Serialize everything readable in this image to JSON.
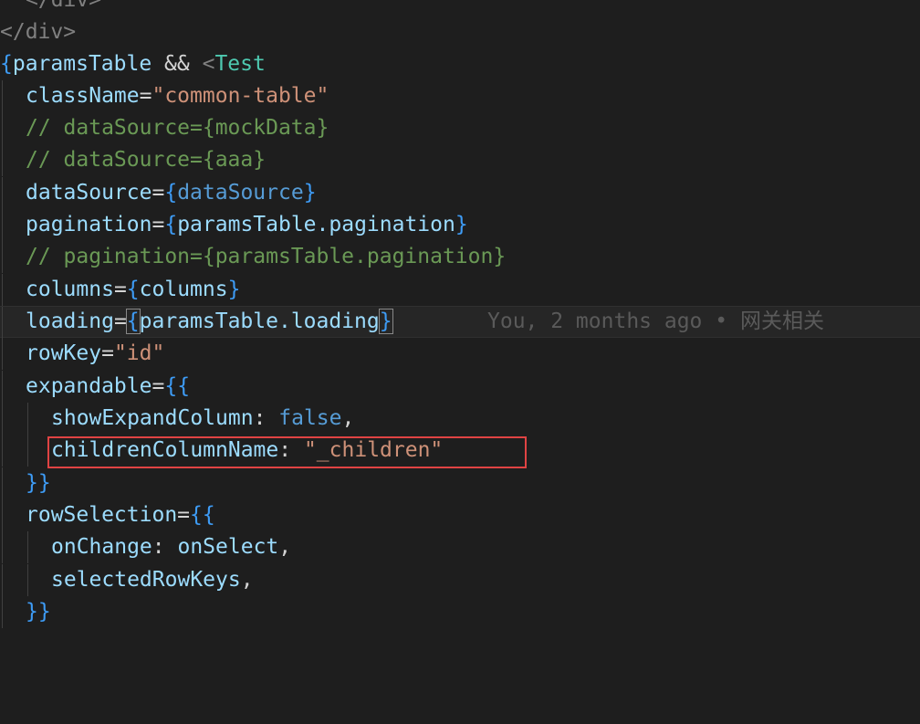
{
  "code": {
    "l0_close": "</div>",
    "l1_close": "</div>",
    "l2": {
      "open": "{",
      "ident": "paramsTable",
      "op": " && ",
      "lt": "<",
      "comp": "Test"
    },
    "l3": {
      "attr": "className",
      "eq": "=",
      "val": "\"common-table\""
    },
    "l4": "// dataSource={mockData}",
    "l5": "// dataSource={aaa}",
    "l6": {
      "attr": "dataSource",
      "eq": "=",
      "open": "{",
      "val": "dataSource",
      "close": "}"
    },
    "l7": {
      "attr": "pagination",
      "eq": "=",
      "open": "{",
      "val": "paramsTable.pagination",
      "close": "}"
    },
    "l8": "// pagination={paramsTable.pagination}",
    "l9": {
      "attr": "columns",
      "eq": "=",
      "open": "{",
      "val": "columns",
      "close": "}"
    },
    "l10": {
      "attr": "loading",
      "eq": "=",
      "open": "{",
      "val": "paramsTable.loading",
      "close": "}"
    },
    "l11": {
      "attr": "rowKey",
      "eq": "=",
      "val": "\"id\""
    },
    "l12": {
      "attr": "expandable",
      "eq": "=",
      "open": "{{"
    },
    "l13": {
      "key": "showExpandColumn",
      "colon": ": ",
      "val": "false",
      "comma": ","
    },
    "l14": {
      "key": "childrenColumnName",
      "colon": ": ",
      "val": "\"_children\""
    },
    "l15": {
      "close": "}}"
    },
    "l16": {
      "attr": "rowSelection",
      "eq": "=",
      "open": "{{"
    },
    "l17": {
      "key": "onChange",
      "colon": ": ",
      "val": "onSelect",
      "comma": ","
    },
    "l18": {
      "key": "selectedRowKeys",
      "comma": ","
    },
    "l19": {
      "close": "}}"
    }
  },
  "blame": {
    "text": "You, 2 months ago • 网关相关"
  }
}
